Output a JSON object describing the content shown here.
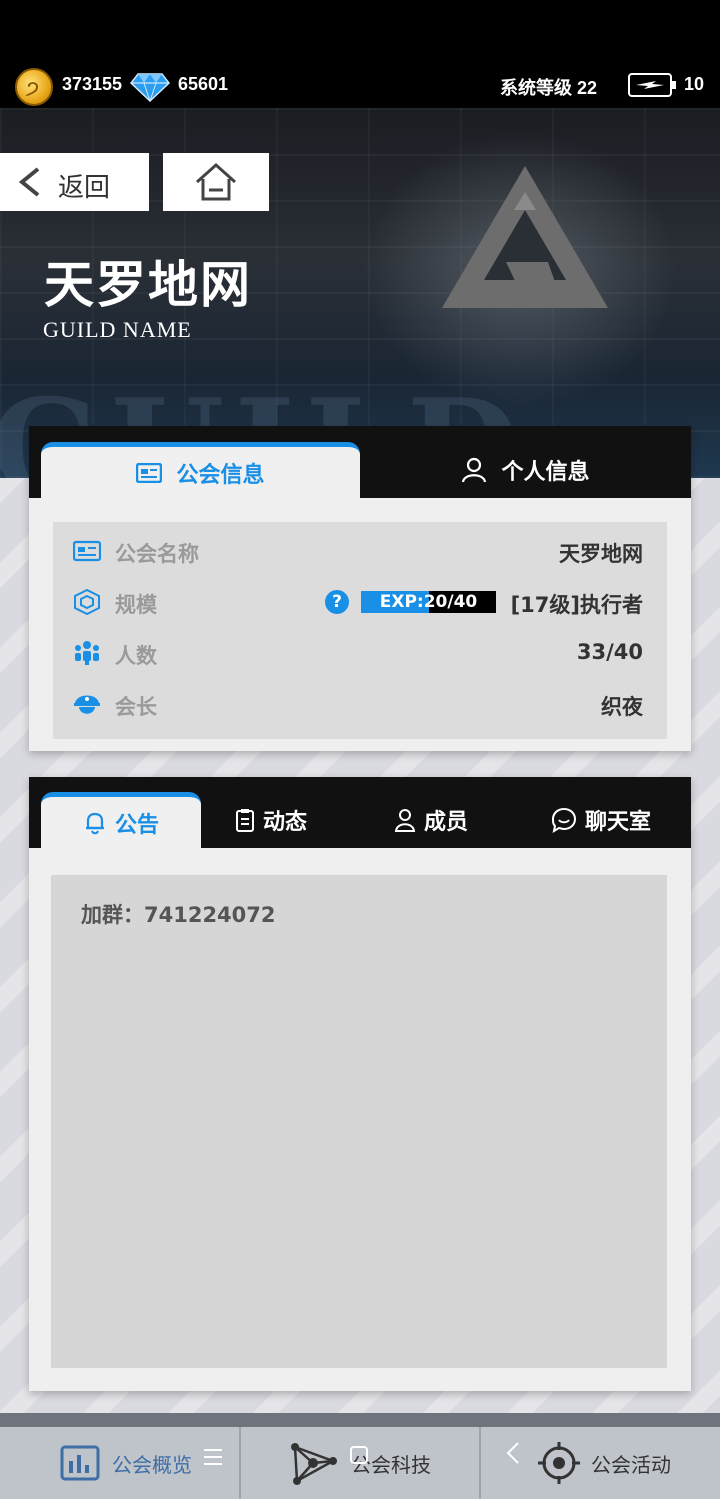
{
  "resources": {
    "coins": "373155",
    "gems": "65601",
    "system_level": "系统等级 22",
    "energy": "10"
  },
  "nav": {
    "back_label": "返回"
  },
  "guild": {
    "title": "天罗地网",
    "subtitle": "GUILD NAME",
    "watermark": "GUILD"
  },
  "info_tabs": [
    {
      "label": "公会信息",
      "active": true
    },
    {
      "label": "个人信息",
      "active": false
    }
  ],
  "info_rows": {
    "name_key": "公会名称",
    "name_val": "天罗地网",
    "scale_key": "规模",
    "help": "?",
    "exp_text": "EXP:20/40",
    "exp_fraction": 0.5,
    "scale_val": "[17级]执行者",
    "members_key": "人数",
    "members_val": "33/40",
    "leader_key": "会长",
    "leader_val": "织夜"
  },
  "notice_tabs": [
    {
      "label": "公告",
      "active": true
    },
    {
      "label": "动态",
      "active": false
    },
    {
      "label": "成员",
      "active": false
    },
    {
      "label": "聊天室",
      "active": false
    }
  ],
  "notice": {
    "text": "加群：741224072"
  },
  "bottom_nav": [
    {
      "label": "公会概览",
      "icon": "chart-icon"
    },
    {
      "label": "公会科技",
      "icon": "network-icon"
    },
    {
      "label": "公会活动",
      "icon": "target-icon"
    }
  ],
  "colors": {
    "accent": "#1a8fe6",
    "tab_bar": "#111111",
    "card_bg": "#efefef"
  }
}
